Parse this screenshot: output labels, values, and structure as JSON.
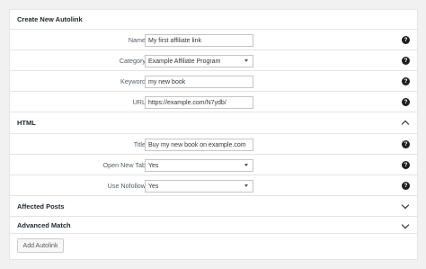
{
  "main": {
    "header": "Create New Autolink",
    "fields": [
      {
        "label": "Name",
        "value": "My first affiliate link"
      },
      {
        "label": "Category",
        "value": "Example Affiliate Program"
      },
      {
        "label": "Keyword",
        "value": "my new book"
      },
      {
        "label": "URL",
        "value": "https://example.com/N7ydb/"
      }
    ]
  },
  "html_section": {
    "header": "HTML",
    "fields": [
      {
        "label": "Title",
        "value": "Buy my new book on example.com"
      },
      {
        "label": "Open New Tab",
        "value": "Yes"
      },
      {
        "label": "Use Nofollow",
        "value": "Yes"
      }
    ]
  },
  "affected_posts": {
    "header": "Affected Posts"
  },
  "advanced_match": {
    "header": "Advanced Match"
  },
  "add_button": "Add Autolink",
  "help_glyph": "?",
  "icons": {
    "help": "question-circle-icon",
    "collapse": "chevron-up-icon",
    "expand": "chevron-down-icon",
    "dropdown": "caret-down-icon"
  }
}
